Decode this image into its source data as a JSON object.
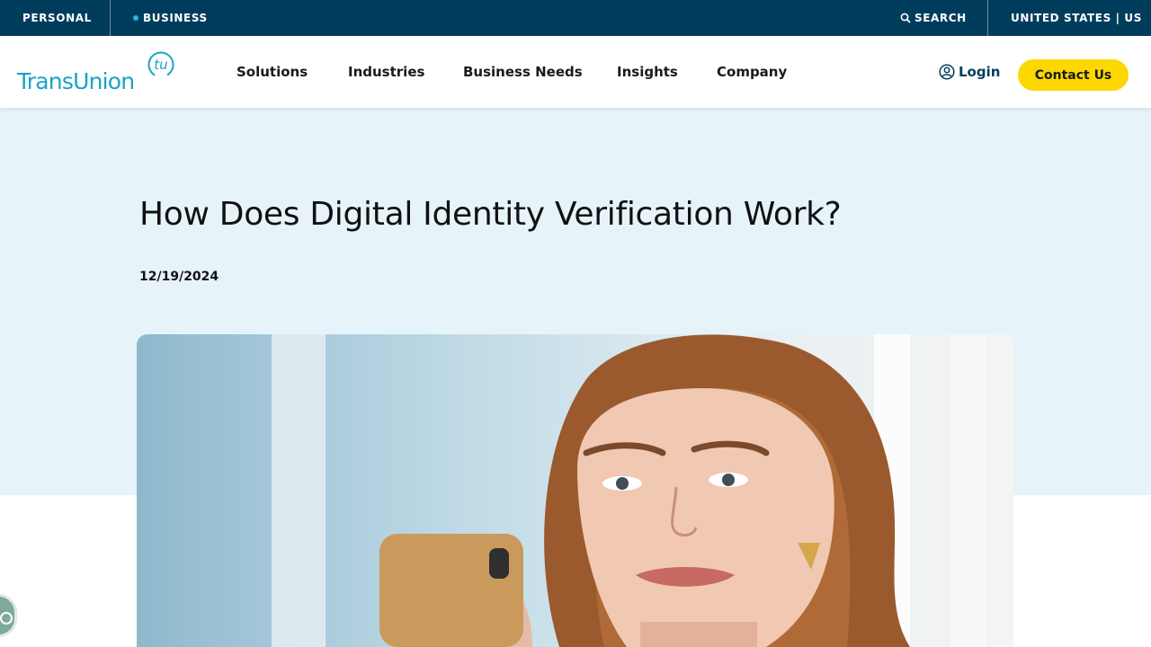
{
  "topbar": {
    "personal": "PERSONAL",
    "business": "BUSINESS",
    "search": "SEARCH",
    "country": "UNITED STATES | US"
  },
  "brand": {
    "name": "TransUnion",
    "mark": "tu"
  },
  "nav": {
    "solutions": "Solutions",
    "industries": "Industries",
    "business_needs": "Business Needs",
    "insights": "Insights",
    "company": "Company",
    "login": "Login",
    "contact": "Contact Us"
  },
  "article": {
    "title": "How Does Digital Identity Verification Work?",
    "date": "12/19/2024"
  },
  "colors": {
    "topbar": "#003d5c",
    "brand": "#1aa3c8",
    "cta": "#fcd800",
    "hero_bg": "#e6f4f9"
  }
}
